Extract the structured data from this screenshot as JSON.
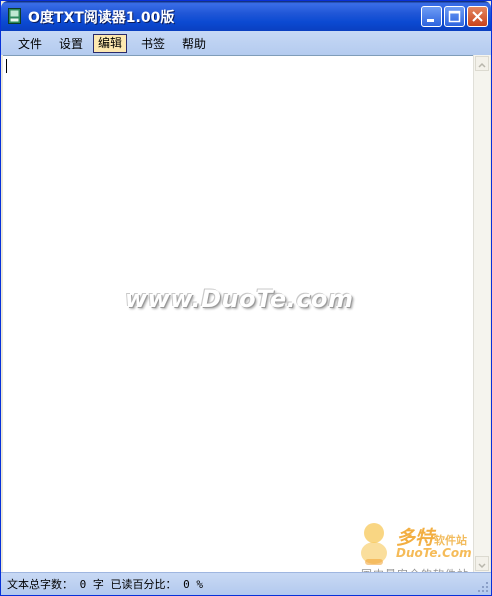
{
  "window": {
    "title": "O度TXT阅读器1.00版"
  },
  "menu": {
    "items": [
      {
        "label": "文件"
      },
      {
        "label": "设置"
      },
      {
        "label": "编辑"
      },
      {
        "label": "书签"
      },
      {
        "label": "帮助"
      }
    ],
    "active_index": 2
  },
  "watermark": {
    "text": "www.DuoTe.com"
  },
  "logo": {
    "name": "多特",
    "subname": "软件站",
    "url": "DuoTe.Com",
    "slogan": "国内最安全的软件站"
  },
  "status": {
    "text": "文本总字数： 0 字 已读百分比： 0 %"
  },
  "colors": {
    "titlebar": "#0b4ad2",
    "menubar": "#c6d8f5",
    "active_menu": "#fde8b0",
    "close_button": "#c8431b"
  },
  "icons": {
    "app": "book-icon",
    "minimize": "minimize-icon",
    "maximize": "maximize-icon",
    "close": "close-icon"
  }
}
